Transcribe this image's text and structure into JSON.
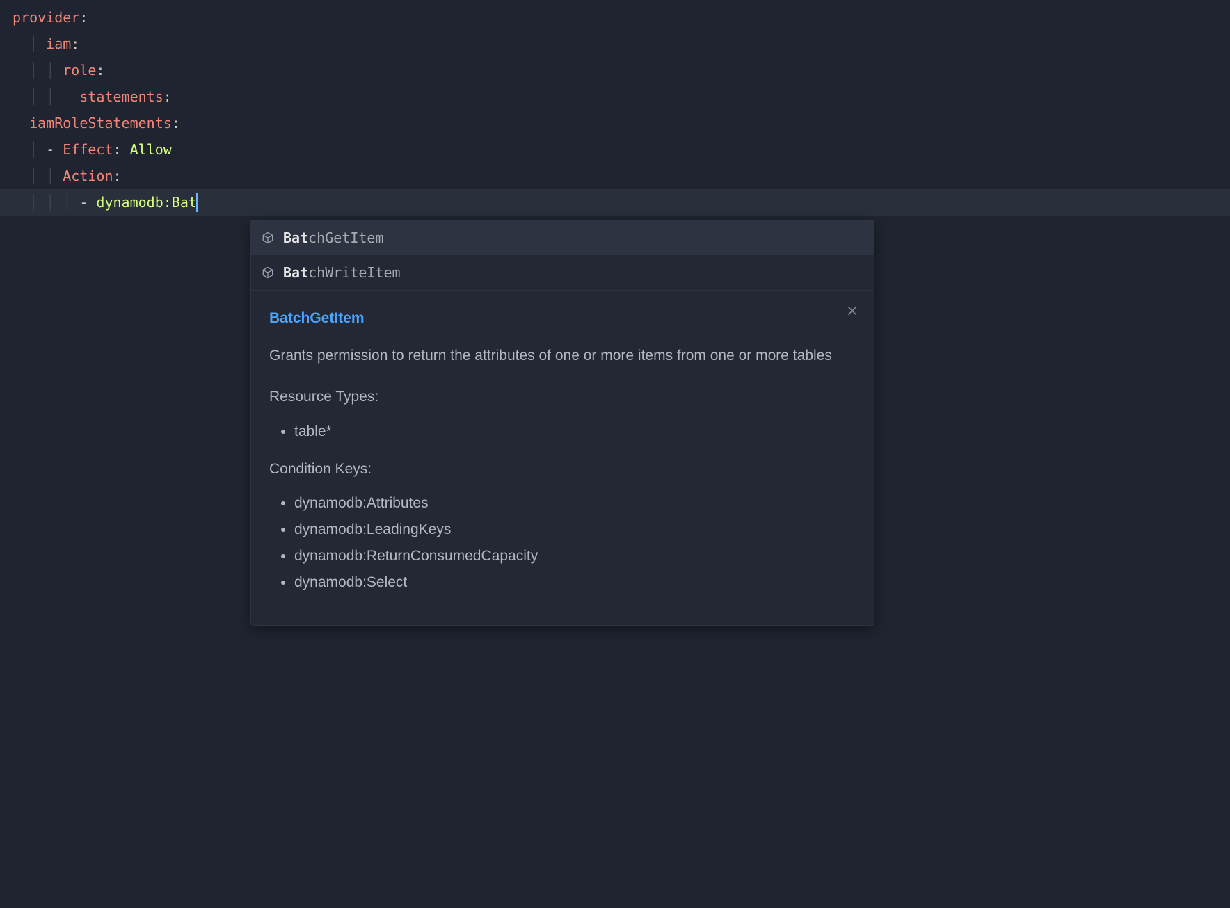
{
  "code": {
    "l0": {
      "key": "provider",
      "colon": ":"
    },
    "l1": {
      "key": "iam",
      "colon": ":"
    },
    "l2": {
      "key": "role",
      "colon": ":"
    },
    "l3": {
      "key": "statements",
      "colon": ":"
    },
    "l4": {
      "key": "iamRoleStatements",
      "colon": ":"
    },
    "l5": {
      "dash": "- ",
      "key": "Effect",
      "colon": ": ",
      "val": "Allow"
    },
    "l6": {
      "key": "Action",
      "colon": ":"
    },
    "l7": {
      "dash": "- ",
      "prefix": "dynamodb",
      "colon": ":",
      "typed": "Bat"
    }
  },
  "suggestions": [
    {
      "match": "Bat",
      "rest": "chGetItem",
      "selected": true
    },
    {
      "match": "Bat",
      "rest": "chWriteItem",
      "selected": false
    }
  ],
  "docs": {
    "title": "BatchGetItem",
    "description": "Grants permission to return the attributes of one or more items from one or more tables",
    "resourceTypesLabel": "Resource Types:",
    "resourceTypes": [
      "table*"
    ],
    "conditionKeysLabel": "Condition Keys:",
    "conditionKeys": [
      "dynamodb:Attributes",
      "dynamodb:LeadingKeys",
      "dynamodb:ReturnConsumedCapacity",
      "dynamodb:Select"
    ]
  }
}
